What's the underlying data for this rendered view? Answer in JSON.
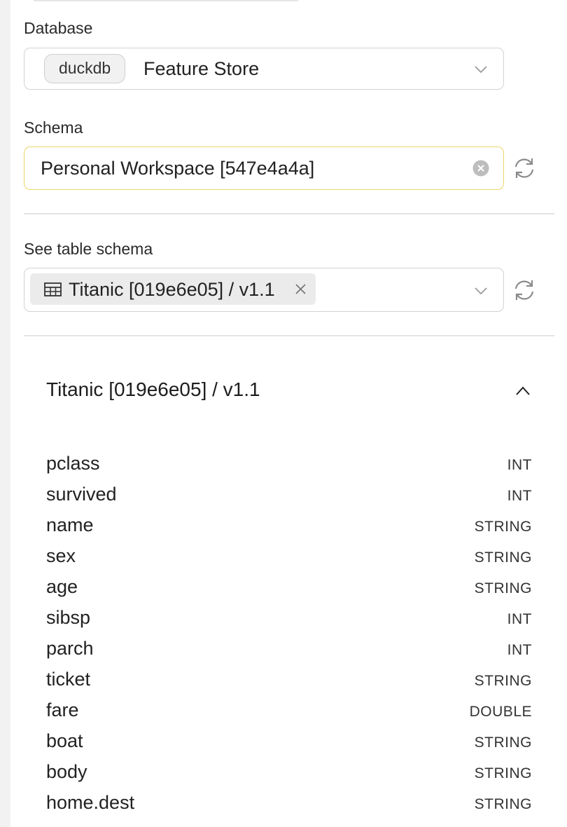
{
  "database": {
    "label": "Database",
    "engine_badge": "duckdb",
    "value": "Feature Store"
  },
  "schema": {
    "label": "Schema",
    "value": "Personal Workspace [547e4a4a]"
  },
  "table_schema": {
    "label": "See table schema",
    "selected_tag": "Titanic [019e6e05] / v1.1"
  },
  "table_panel": {
    "title": "Titanic [019e6e05] / v1.1",
    "columns": [
      {
        "name": "pclass",
        "type": "INT"
      },
      {
        "name": "survived",
        "type": "INT"
      },
      {
        "name": "name",
        "type": "STRING"
      },
      {
        "name": "sex",
        "type": "STRING"
      },
      {
        "name": "age",
        "type": "STRING"
      },
      {
        "name": "sibsp",
        "type": "INT"
      },
      {
        "name": "parch",
        "type": "INT"
      },
      {
        "name": "ticket",
        "type": "STRING"
      },
      {
        "name": "fare",
        "type": "DOUBLE"
      },
      {
        "name": "boat",
        "type": "STRING"
      },
      {
        "name": "body",
        "type": "STRING"
      },
      {
        "name": "home.dest",
        "type": "STRING"
      }
    ]
  },
  "colors": {
    "focused_border": "#ebd76a",
    "border": "#d2d2d2",
    "tag_bg": "#ebebeb"
  },
  "icons": [
    "chevron-down-icon",
    "clear-icon",
    "refresh-icon",
    "table-grid-icon",
    "close-icon",
    "chevron-up-icon"
  ]
}
